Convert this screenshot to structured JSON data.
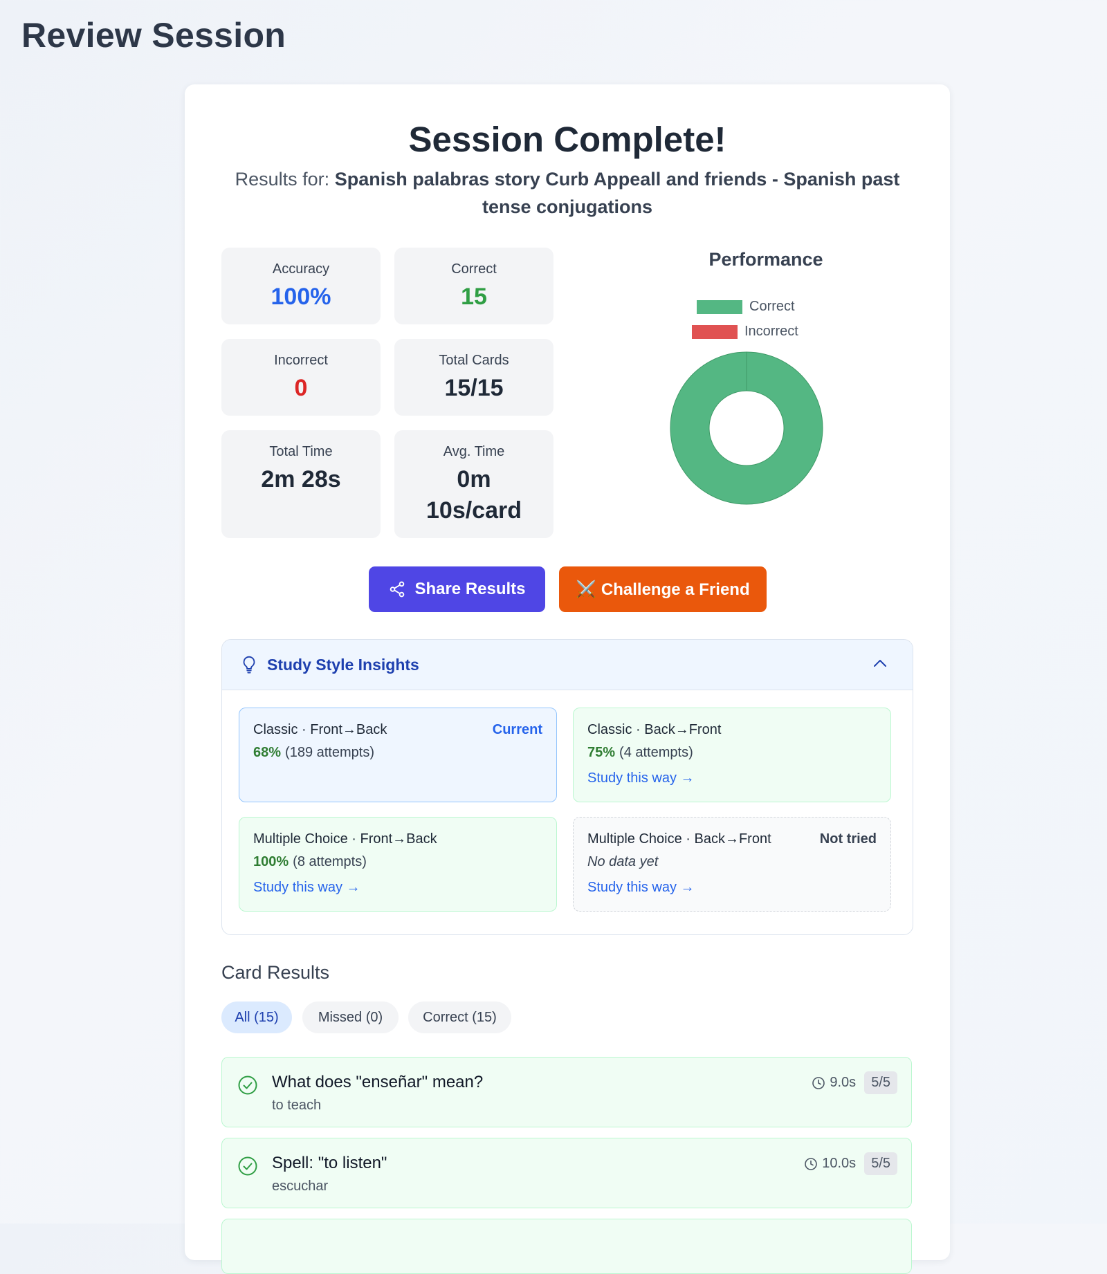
{
  "page": {
    "title": "Review Session"
  },
  "summary": {
    "heading": "Session Complete!",
    "results_prefix": "Results for:",
    "deck_name": "Spanish palabras story Curb Appeall and friends - Spanish past tense conjugations"
  },
  "stats": {
    "accuracy": {
      "label": "Accuracy",
      "value": "100%"
    },
    "correct": {
      "label": "Correct",
      "value": "15"
    },
    "incorrect": {
      "label": "Incorrect",
      "value": "0"
    },
    "total_cards": {
      "label": "Total Cards",
      "value": "15/15"
    },
    "total_time": {
      "label": "Total Time",
      "value": "2m 28s"
    },
    "avg_time": {
      "label": "Avg. Time",
      "value_line1": "0m",
      "value_line2": "10s/card"
    }
  },
  "chart_data": {
    "type": "pie",
    "title": "Performance",
    "categories": [
      "Correct",
      "Incorrect"
    ],
    "values": [
      15,
      0
    ],
    "colors": [
      "#54b783",
      "#e05252"
    ],
    "legend_position": "top"
  },
  "actions": {
    "share_label": "Share Results",
    "challenge_label": "⚔️ Challenge a Friend",
    "share_color": "#4f46e5",
    "challenge_color": "#ea580c"
  },
  "insights": {
    "title": "Study Style Insights",
    "modes": [
      {
        "name": "Classic · Front→Back",
        "tag": "Current",
        "accuracy": "68%",
        "attempts": "(189 attempts)"
      },
      {
        "name": "Classic · Back→Front",
        "accuracy": "75%",
        "attempts": "(4 attempts)",
        "link": "Study this way →"
      },
      {
        "name": "Multiple Choice · Front→Back",
        "accuracy": "100%",
        "attempts": "(8 attempts)",
        "link": "Study this way →"
      },
      {
        "name": "Multiple Choice · Back→Front",
        "tag": "Not tried",
        "note": "No data yet",
        "link": "Study this way →"
      }
    ]
  },
  "card_results": {
    "title": "Card Results",
    "filters": [
      {
        "label": "All (15)",
        "active": true
      },
      {
        "label": "Missed (0)",
        "active": false
      },
      {
        "label": "Correct (15)",
        "active": false
      }
    ],
    "items": [
      {
        "question": "What does \"enseñar\" mean?",
        "answer": "to teach",
        "time": "9.0s",
        "score": "5/5"
      },
      {
        "question": "Spell: \"to listen\"",
        "answer": "escuchar",
        "time": "10.0s",
        "score": "5/5"
      }
    ]
  }
}
